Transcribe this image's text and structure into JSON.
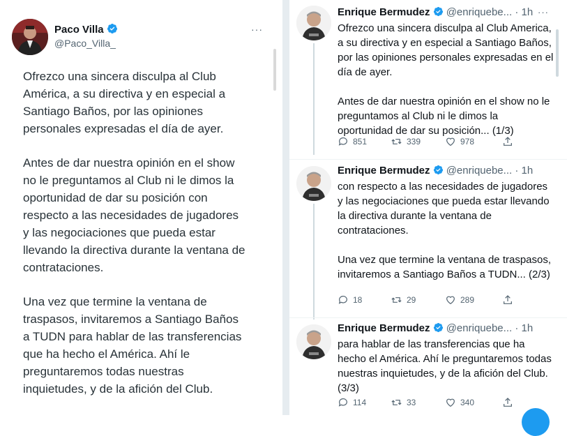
{
  "left": {
    "name": "Paco Villa",
    "handle": "@Paco_Villa_",
    "more": "···",
    "paragraphs": [
      "Ofrezco una sincera disculpa al Club\nAmérica, a su directiva y en especial a\nSantiago Baños, por las opiniones\npersonales expresadas el día de ayer.",
      "Antes de dar nuestra opinión en el show\nno le preguntamos al Club ni le dimos la\noportunidad de dar su posición con\nrespecto a las necesidades de jugadores\ny las negociaciones que pueda estar\nllevando la directiva durante la ventana de\ncontrataciones.",
      "Una vez que termine la ventana de\ntraspasos, invitaremos a Santiago Baños\na TUDN para hablar de las transferencias\nque ha hecho el América. Ahí le\npreguntaremos todas nuestras\ninquietudes, y de la afición del Club."
    ]
  },
  "thread": [
    {
      "name": "Enrique Bermudez",
      "handle": "@enriquebe...",
      "time": "· 1h",
      "more": "···",
      "paragraphs": [
        "Ofrezco una sincera disculpa al Club America, a su directiva y en especial a Santiago Baños, por las opiniones personales expresadas en el día de ayer.",
        "Antes de dar nuestra opinión en el show no le preguntamos al Club ni le dimos la oportunidad de dar su posición... (1/3)"
      ],
      "replies": "851",
      "retweets": "339",
      "likes": "978"
    },
    {
      "name": "Enrique Bermudez",
      "handle": "@enriquebe...",
      "time": "· 1h",
      "more": "···",
      "paragraphs": [
        "con respecto a las necesidades de jugadores y las negociaciones que pueda estar llevando la directiva durante la ventana de contrataciones.",
        "Una vez que termine la ventana de traspasos, invitaremos a Santiago Baños a TUDN... (2/3)"
      ],
      "replies": "18",
      "retweets": "29",
      "likes": "289"
    },
    {
      "name": "Enrique Bermudez",
      "handle": "@enriquebe...",
      "time": "· 1h",
      "more": "···",
      "paragraphs": [
        "para hablar de las transferencias que ha hecho el América. Ahí le preguntaremos todas nuestras inquietudes, y de la afición del Club. (3/3)"
      ],
      "replies": "114",
      "retweets": "33",
      "likes": "340"
    }
  ],
  "colors": {
    "verified": "#1d9bf0",
    "secondary_text": "#536471",
    "thread_line": "#cfd9de"
  }
}
